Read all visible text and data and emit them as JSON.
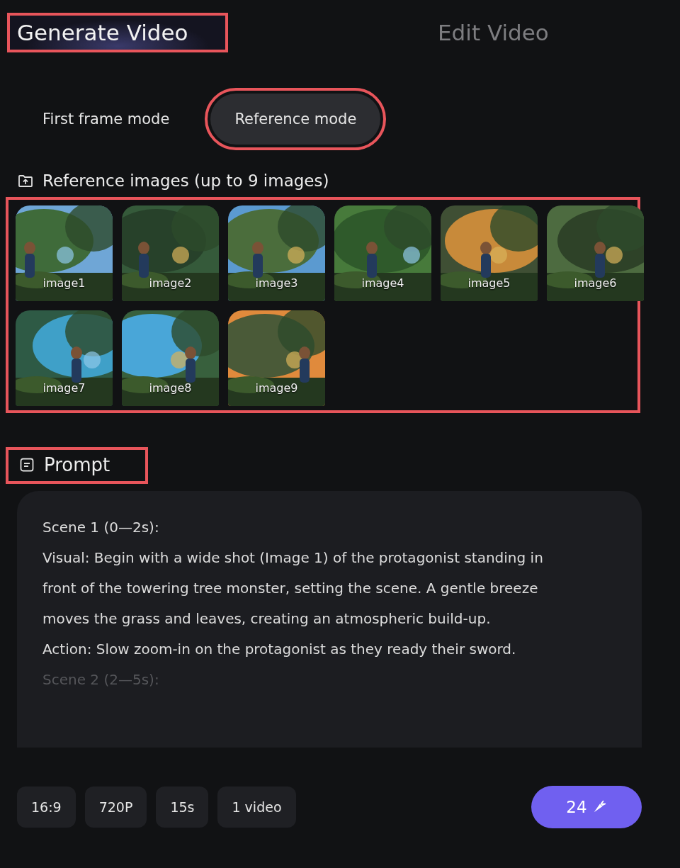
{
  "tabs": [
    {
      "label": "Generate Video",
      "selected": true,
      "highlighted": true
    },
    {
      "label": "Edit Video",
      "selected": false,
      "highlighted": false
    }
  ],
  "modes": [
    {
      "label": "First frame mode",
      "selected": false,
      "highlighted": false
    },
    {
      "label": "Reference mode",
      "selected": true,
      "highlighted": true
    }
  ],
  "reference_images": {
    "label": "Reference images (up to 9 images)",
    "highlighted": true,
    "images": [
      {
        "kind": "picture",
        "caption": "image1"
      },
      {
        "kind": "picture",
        "caption": "image2"
      },
      {
        "kind": "picture",
        "caption": "image3"
      },
      {
        "kind": "picture",
        "caption": "image4"
      },
      {
        "kind": "picture",
        "caption": "image5"
      },
      {
        "kind": "picture",
        "caption": "image6"
      },
      {
        "kind": "picture",
        "caption": "image7"
      },
      {
        "kind": "picture",
        "caption": "image8"
      },
      {
        "kind": "picture",
        "caption": "image9"
      }
    ]
  },
  "prompt": {
    "label": "Prompt",
    "highlighted": true,
    "lines": [
      "Scene 1 (0—2s):",
      "Visual: Begin with a wide shot (Image 1) of the protagonist standing in front of the towering tree monster, setting the scene. A gentle breeze moves the grass and leaves, creating an atmospheric build-up.",
      "Action: Slow zoom-in on the protagonist as they ready their sword.",
      "Scene 2 (2—5s):"
    ]
  },
  "options": [
    "16:9",
    "720P",
    "15s",
    "1 video"
  ],
  "generate_button": {
    "label": "24"
  }
}
